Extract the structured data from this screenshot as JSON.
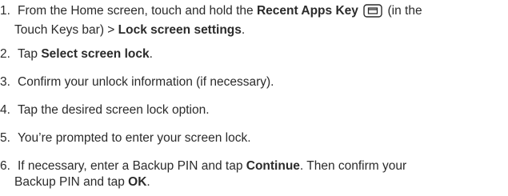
{
  "steps": [
    {
      "num": "1.",
      "line1_a": "From the Home screen, touch and hold the ",
      "line1_bold": "Recent Apps Key",
      "icon": "recent-apps-key-icon",
      "line1_b": " (in the",
      "line2_a": "Touch Keys bar) > ",
      "line2_bold": "Lock screen settings",
      "line2_b": "."
    },
    {
      "num": "2.",
      "a": "Tap ",
      "bold": "Select screen lock",
      "b": "."
    },
    {
      "num": "3.",
      "a": "Confirm your unlock information (if necessary)."
    },
    {
      "num": "4.",
      "a": "Tap the desired screen lock option."
    },
    {
      "num": "5.",
      "a": "You’re prompted to enter your screen lock."
    },
    {
      "num": "6.",
      "line1_a": "If necessary, enter a Backup PIN and tap ",
      "line1_bold": "Continue",
      "line1_b": ". Then confirm your",
      "line2_a": "Backup PIN and tap ",
      "line2_bold": "OK",
      "line2_b": "."
    }
  ]
}
